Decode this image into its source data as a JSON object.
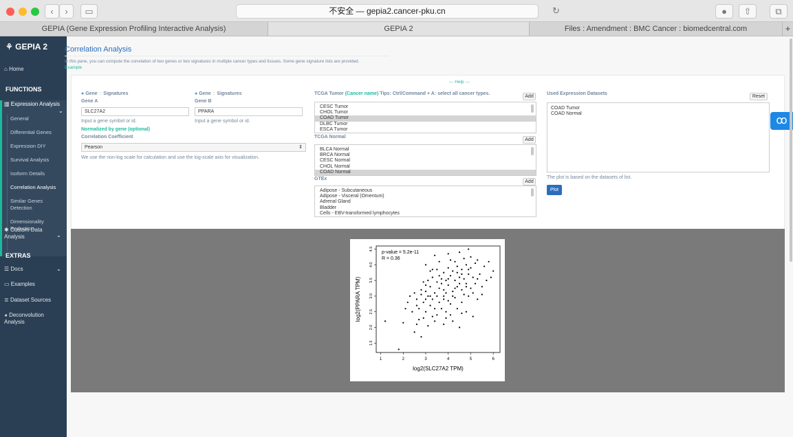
{
  "browser": {
    "url_prefix": "不安全 — ",
    "url_host": "gepia2.cancer-pku.cn",
    "tabs": [
      "GEPIA (Gene Expression Profiling Interactive Analysis)",
      "GEPIA 2",
      "Files : Amendment : BMC Cancer : biomedcentral.com"
    ],
    "new_tab": "+"
  },
  "sidebar": {
    "logo": "GEPIA 2",
    "home": "Home",
    "functions_header": "FUNCTIONS",
    "expression_analysis": "Expression Analysis",
    "subitems": [
      "General",
      "Differential Genes",
      "Expression DIY",
      "Survival Analysis",
      "Isoform Details",
      "Correlation Analysis",
      "Similar Genes Detection",
      "Dimensionality Reduction"
    ],
    "custom_data": "Custom Data Analysis",
    "extras_header": "EXTRAS",
    "docs": "Docs",
    "examples": "Examples",
    "dataset_sources": "Dataset Sources",
    "deconvolution": "Deconvolution Analysis"
  },
  "page": {
    "title": "Correlation Analysis",
    "description": "In this pane, you can compute the correlation of two genes or two signatures in multiple cancer types and tissues. Some gene signature lists are provided.",
    "example_link": "Example",
    "help_link": "--- Help ---"
  },
  "form": {
    "gene_a": {
      "radio_gene": "Gene",
      "radio_sep": "::",
      "radio_sig": "Signatures",
      "label": "Gene A",
      "value": "SLC27A2",
      "hint": "Input a gene symbol or id."
    },
    "gene_b": {
      "radio_gene": "Gene",
      "radio_sep": "::",
      "radio_sig": "Signatures",
      "label": "Gene B",
      "value": "PPARA",
      "hint": "Input a gene symbol or id."
    },
    "normalized_label": "Normalized by gene (optional)",
    "coef_label": "Correlation Coefficient",
    "coef_value": "Pearson",
    "scale_note": "We use the non-log scale for calculation and use the log-scale axis for visualization.",
    "tcga_tumor": {
      "label_prefix": "TCGA Tumor ",
      "label_accent": "(Cancer name)",
      "label_suffix": " Tips: Ctrl/Command + A: select all cancer types.",
      "items": [
        "CESC Tumor",
        "CHOL Tumor",
        "COAD Tumor",
        "DLBC Tumor",
        "ESCA Tumor"
      ],
      "selected": "COAD Tumor"
    },
    "tcga_normal": {
      "label": "TCGA Normal",
      "items": [
        "BLCA Normal",
        "BRCA Normal",
        "CESC Normal",
        "CHOL Normal",
        "COAD Normal"
      ],
      "selected": "COAD Normal"
    },
    "gtex": {
      "label": "GTEx",
      "items": [
        "Adipose - Subcutaneous",
        "Adipose - Visceral (Omentum)",
        "Adrenal Gland",
        "Bladder",
        "Cells - EBV-transformed lymphocytes"
      ]
    },
    "add_label": "Add",
    "used": {
      "label": "Used Expression Datasets",
      "reset": "Reset",
      "items": [
        "COAD Tumor",
        "COAD Normal"
      ],
      "note": "The plot is based on the datasets of list.",
      "plot_button": "Plot"
    }
  },
  "colors": {
    "sidebar": "#2a3f54",
    "accent": "#1abb9c",
    "plot_button": "#2a6ebb",
    "plot_bg": "#7a7a7a"
  },
  "chart_data": {
    "type": "scatter",
    "xlabel": "log2(SLC27A2 TPM)",
    "ylabel": "log2(PPARA TPM)",
    "xlim": [
      0.8,
      6.3
    ],
    "ylim": [
      1.2,
      4.6
    ],
    "xticks": [
      1,
      2,
      3,
      4,
      5,
      6
    ],
    "yticks": [
      1.5,
      2.0,
      2.5,
      3.0,
      3.5,
      4.0,
      4.5
    ],
    "annotations": [
      "p-value = 5.2e-11",
      "R = 0.36"
    ],
    "points": [
      [
        1.8,
        1.3
      ],
      [
        2.8,
        1.7
      ],
      [
        2.5,
        1.85
      ],
      [
        1.2,
        2.2
      ],
      [
        2.0,
        2.15
      ],
      [
        2.6,
        2.1
      ],
      [
        3.1,
        2.05
      ],
      [
        2.9,
        2.3
      ],
      [
        3.4,
        2.2
      ],
      [
        3.8,
        2.1
      ],
      [
        4.2,
        2.2
      ],
      [
        4.5,
        2.0
      ],
      [
        2.4,
        2.5
      ],
      [
        2.7,
        2.6
      ],
      [
        3.0,
        2.5
      ],
      [
        3.2,
        2.7
      ],
      [
        3.5,
        2.4
      ],
      [
        3.7,
        2.6
      ],
      [
        3.9,
        2.5
      ],
      [
        4.1,
        2.4
      ],
      [
        4.4,
        2.6
      ],
      [
        4.8,
        2.5
      ],
      [
        5.1,
        2.35
      ],
      [
        2.2,
        2.8
      ],
      [
        2.6,
        2.9
      ],
      [
        2.9,
        2.8
      ],
      [
        3.1,
        3.0
      ],
      [
        3.3,
        2.9
      ],
      [
        3.6,
        2.8
      ],
      [
        3.8,
        3.0
      ],
      [
        4.0,
        2.85
      ],
      [
        4.3,
        2.95
      ],
      [
        4.6,
        2.8
      ],
      [
        4.9,
        3.0
      ],
      [
        5.3,
        2.9
      ],
      [
        2.5,
        3.1
      ],
      [
        2.8,
        3.2
      ],
      [
        3.0,
        3.15
      ],
      [
        3.2,
        3.3
      ],
      [
        3.4,
        3.1
      ],
      [
        3.6,
        3.25
      ],
      [
        3.8,
        3.2
      ],
      [
        4.0,
        3.35
      ],
      [
        4.2,
        3.15
      ],
      [
        4.4,
        3.3
      ],
      [
        4.6,
        3.2
      ],
      [
        4.8,
        3.4
      ],
      [
        5.0,
        3.25
      ],
      [
        5.2,
        3.4
      ],
      [
        5.5,
        3.3
      ],
      [
        2.9,
        3.45
      ],
      [
        3.1,
        3.5
      ],
      [
        3.3,
        3.6
      ],
      [
        3.5,
        3.45
      ],
      [
        3.7,
        3.55
      ],
      [
        3.9,
        3.5
      ],
      [
        4.1,
        3.65
      ],
      [
        4.3,
        3.5
      ],
      [
        4.5,
        3.6
      ],
      [
        4.7,
        3.55
      ],
      [
        4.9,
        3.7
      ],
      [
        5.1,
        3.6
      ],
      [
        5.4,
        3.7
      ],
      [
        5.7,
        3.5
      ],
      [
        3.2,
        3.8
      ],
      [
        3.5,
        3.85
      ],
      [
        3.8,
        3.75
      ],
      [
        4.0,
        3.9
      ],
      [
        4.2,
        3.8
      ],
      [
        4.4,
        3.95
      ],
      [
        4.6,
        3.85
      ],
      [
        4.8,
        4.0
      ],
      [
        5.0,
        3.9
      ],
      [
        5.2,
        4.05
      ],
      [
        5.6,
        3.95
      ],
      [
        3.0,
        4.0
      ],
      [
        3.6,
        4.1
      ],
      [
        4.1,
        4.15
      ],
      [
        4.3,
        4.1
      ],
      [
        4.7,
        4.2
      ],
      [
        5.0,
        4.25
      ],
      [
        5.3,
        4.15
      ],
      [
        3.4,
        4.3
      ],
      [
        4.0,
        4.35
      ],
      [
        4.5,
        4.4
      ],
      [
        4.9,
        4.5
      ],
      [
        5.8,
        4.1
      ],
      [
        6.0,
        3.8
      ],
      [
        2.3,
        3.0
      ],
      [
        2.1,
        2.6
      ],
      [
        3.9,
        2.3
      ],
      [
        4.6,
        2.45
      ],
      [
        3.3,
        2.35
      ],
      [
        2.7,
        2.25
      ],
      [
        5.5,
        3.05
      ],
      [
        5.9,
        3.6
      ],
      [
        4.2,
        3.0
      ],
      [
        3.0,
        2.9
      ],
      [
        3.7,
        3.4
      ],
      [
        4.4,
        3.75
      ],
      [
        3.5,
        3.0
      ],
      [
        3.9,
        3.1
      ],
      [
        4.1,
        2.75
      ],
      [
        4.7,
        3.05
      ],
      [
        2.6,
        2.7
      ],
      [
        3.2,
        3.0
      ],
      [
        3.4,
        2.6
      ],
      [
        4.5,
        3.4
      ],
      [
        4.0,
        3.55
      ],
      [
        3.6,
        3.65
      ],
      [
        4.8,
        3.3
      ],
      [
        5.1,
        3.1
      ],
      [
        3.0,
        3.35
      ],
      [
        2.8,
        3.05
      ],
      [
        4.3,
        3.25
      ],
      [
        3.8,
        2.9
      ],
      [
        4.6,
        3.7
      ],
      [
        5.3,
        3.55
      ],
      [
        3.3,
        3.85
      ],
      [
        4.9,
        3.85
      ]
    ]
  }
}
